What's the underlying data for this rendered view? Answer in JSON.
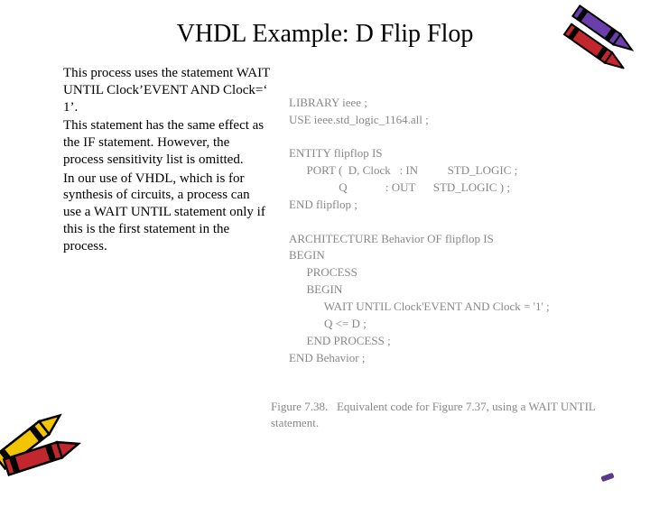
{
  "title": "VHDL Example: D Flip Flop",
  "left": {
    "p1": "This process uses the statement WAIT UNTIL Clock’EVENT AND Clock=‘ 1’.",
    "p2": "This statement has the same effect as the IF statement. However, the process sensitivity list is omitted.",
    "p3": "In our use of VHDL, which is for synthesis of circuits, a process can use a WAIT UNTIL statement only if this is the first statement in the process."
  },
  "code": {
    "l1": "LIBRARY ieee ;",
    "l2": "USE ieee.std_logic_1164.all ;",
    "l3": "",
    "l4": "ENTITY flipflop IS",
    "l5": "      PORT (  D, Clock   : IN          STD_LOGIC ;",
    "l6": "                 Q             : OUT      STD_LOGIC ) ;",
    "l7": "END flipflop ;",
    "l8": "",
    "l9": "ARCHITECTURE Behavior OF flipflop IS",
    "l10": "BEGIN",
    "l11": "      PROCESS",
    "l12": "      BEGIN",
    "l13": "            WAIT UNTIL Clock'EVENT AND Clock = '1' ;",
    "l14": "            Q <= D ;",
    "l15": "      END PROCESS ;",
    "l16": "END Behavior ;"
  },
  "caption": {
    "label": "Figure 7.38.",
    "text": "Equivalent code for Figure 7.37, using a WAIT UNTIL statement."
  }
}
